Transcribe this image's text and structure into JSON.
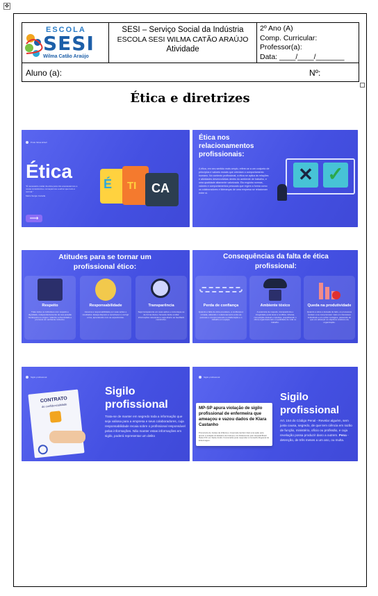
{
  "header": {
    "logo_top": "ESCOLA",
    "logo_main": "SESI",
    "logo_sub": "Wilma Catão Araújo",
    "org_line1": "SESI – Serviço Social da Indústria",
    "org_line2": "ESCOLA SESI WILMA CATÃO ARAÚJO",
    "org_line3": "Atividade",
    "grade": "2º Ano (A)",
    "subject": "Comp. Curricular:",
    "teacher": "Professor(a):",
    "date": "Data: ____/____/_______",
    "student": "Aluno (a):",
    "number": "Nº:"
  },
  "title": "Ética e diretrizes",
  "slides": {
    "s1": {
      "tag": "Profe Silvia Ethell",
      "title": "Ética",
      "quote": "\"É necessário cuidar da ética para não anestesiarmos a nossa consciência e começarmos a achar que tudo é normal.\"",
      "author": "Mario Sergio Cortella",
      "arrow": "⟶",
      "puzzle": [
        "É",
        "TI",
        "CA"
      ]
    },
    "s2": {
      "title": "Ética nos relacionamentos profissionais:",
      "text": "A ética, em seu sentido mais amplo, refere-se a um conjunto de princípios e valores morais que orientam o comportamento humano. No contexto profissional, a ética se aplica às relações e atividades desenvolvidas dentro do ambiente de trabalho, e uma qualidade altamente valorizada. Ela engloba normas, valores e comportamentos pessoais que regem a forma como os colaboradores e lideranças de uma empresa se relacionam entre si."
    },
    "s3": {
      "title": "Atitudes para se tornar um profissional ético:",
      "cards": [
        {
          "name": "Respeito",
          "text": "Trate todos os indivíduos com respeito e dignidade, independentemente de sua posição hierárquica ou origem. Valorize a diversidade e promova um ambiente inclusivo."
        },
        {
          "name": "Responsabilidade",
          "text": "Assuma a responsabilidade por suas ações e resultados. Esteja disposto a reconhecer e corrigir erros, aprendendo com as experiências."
        },
        {
          "name": "Transparência",
          "text": "Seja transparente em suas ações e comunique-se de forma clara e honesta. Evite ocultar informações relevantes e seja aberto ao feedback construtivo."
        }
      ]
    },
    "s4": {
      "title": "Consequências da falta de ética profissional:",
      "cards": [
        {
          "name": "Perda de confiança",
          "text": "Quando a falta de ética prevalece, a confiança é minada, afetando o relacionamento entre as pessoas e comprometendo a colaboração e o trabalho em equipe."
        },
        {
          "name": "Ambiente tóxico",
          "text": "A ausência de respeito, transparência e integridade pode levar a conflitos, fofocas, competição desleal e injustiça, prejudicando o clima organizacional e a qualidade de vida no trabalho."
        },
        {
          "name": "Queda na produtividade",
          "text": "Quando a ética é deixada de lado, os processos tendem a se comprometer mais em interesses individuais e em evitar contágios, passando do que em alcançar os objetivos coletivos da organização."
        }
      ]
    },
    "s5": {
      "tag": "Sigilo profissional",
      "contract": "CONTRATO",
      "contract_sub": "de confidencialidade",
      "title": "Sigilo profissional",
      "text": "Trata-se de manter em segredo toda a informação que seja valiosa para a empresa e seus colaboradores, cuja responsabilidade recaia sobre o profissional responsável pelas informações. Não manter estas informações em sigilo, poderá representar um delito"
    },
    "s6": {
      "tag": "Sigilo profissional",
      "news_title": "MP-SP apura violação de sigilo profissional de enfermeira que ameaçou e vazou dados de Klara Castanho",
      "news_body": "Promotoria de Justiça da Infância e Juventude também fará uma ação para apurar a violação do Estatuto da Criança e do Adolescente pelo Hospital Brasil Rede D'Or em Santo André. Funcionária pode responder à Conselho Regional de Enfermagem.",
      "title": "Sigilo profissional",
      "text_pre": "Art. 154 do Código Penal - Revelar alguém, sem justa causa, segredo, de que tem ciência em razão de função, ministério, ofício ou profissão, e cuja revelação possa produzir dano a outrem.",
      "pena_label": "Pena",
      "text_post": "- detenção, de três meses a um ano, ou multa."
    }
  }
}
